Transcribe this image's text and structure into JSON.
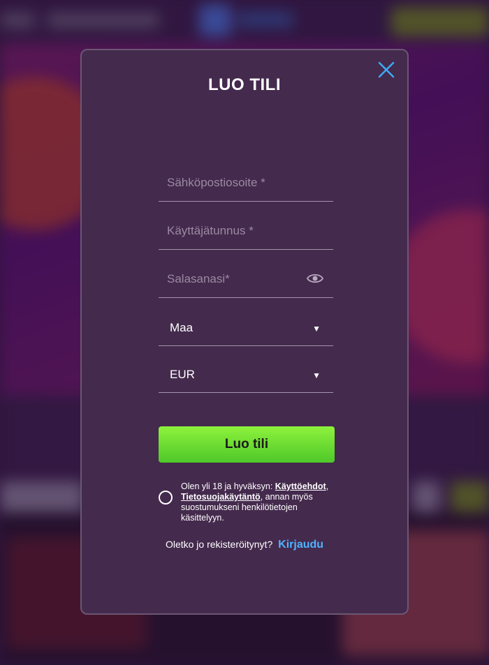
{
  "modal": {
    "title": "LUO TILI",
    "close_icon": "close-icon",
    "email": {
      "placeholder": "Sähköpostiosoite *",
      "value": ""
    },
    "username": {
      "placeholder": "Käyttäjätunnus *",
      "value": ""
    },
    "password": {
      "placeholder": "Salasanasi*",
      "value": "",
      "icon": "eye-icon"
    },
    "country": {
      "value": "Maa"
    },
    "currency": {
      "value": "EUR"
    },
    "submit_label": "Luo tili",
    "terms": {
      "prefix": "Olen yli 18 ja hyväksyn: ",
      "link1": "Käyttöehdot",
      "sep": ",",
      "link2": "Tietosuojakäytäntö",
      "suffix": ", annan myös suostumukseni henkilötietojen käsittelyyn."
    },
    "login": {
      "question": "Oletko jo rekisteröitynyt?",
      "link": "Kirjaudu"
    }
  },
  "colors": {
    "modal_bg": "#442a4d",
    "accent_green": "#6ad934",
    "link_blue": "#4fb3ff",
    "close_blue": "#3fa9f5"
  }
}
